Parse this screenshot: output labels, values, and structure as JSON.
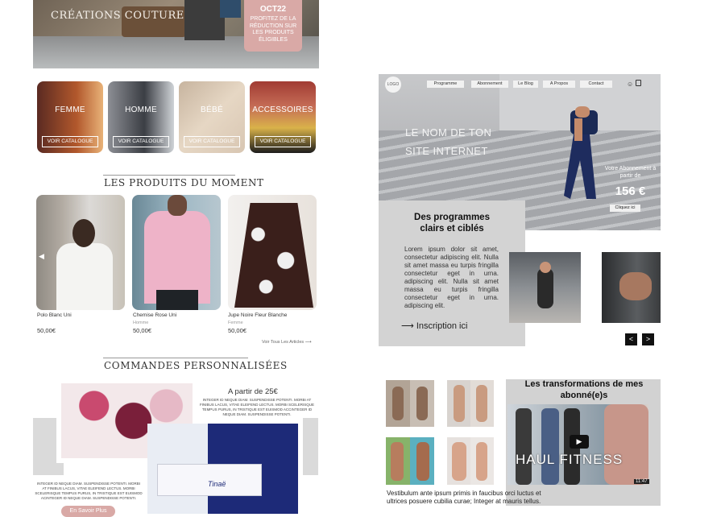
{
  "left_site": {
    "hero_title": "CRÉATIONS COUTURE",
    "promo": {
      "month": "OCT22",
      "text": "PROFITEZ DE LA RÉDUCTION SUR LES PRODUITS ÉLIGIBLES"
    },
    "categories": [
      {
        "label": "FEMME",
        "button": "VOIR CATALOGUE"
      },
      {
        "label": "HOMME",
        "button": "VOIR CATALOGUE"
      },
      {
        "label": "BÉBÉ",
        "button": "VOIR CATALOGUE"
      },
      {
        "label": "ACCESSOIRES",
        "button": "VOIR CATALOGUE"
      }
    ],
    "products_title": "LES PRODUITS DU MOMENT",
    "products": [
      {
        "name": "Polo Blanc Uni",
        "category": "",
        "price": "50,00€"
      },
      {
        "name": "Chemise Rose Uni",
        "category": "Homme",
        "price": "50,00€"
      },
      {
        "name": "Jupe Noire Fleur Blanche",
        "category": "Femme",
        "price": "50,00€"
      }
    ],
    "see_all": "Voir Tous Les Articles",
    "custom_title": "COMMANDES PERSONNALISÉES",
    "custom_price": "A partir de 25€",
    "custom_text_1": "INTEGER ID NEQUE DIAM. SUSPENDISSE POTENTI. MORBI AT FINIBUS LACUS, VITAE ELEIFEND LECTUS. MORBI SCELERISQUE TEMPUS PURUS, IN TRISTIQUE EST EUISMOD ACCINTEGER ID NEQUE DIAM. SUSPENDISSE POTENTI.",
    "custom_text_2": "INTEGER ID NEQUE DIAM. SUSPENDISSE POTENTI. MORBI AT FINIBUS LACUS, VITAE ELEIFEND LECTUS. MORBI SCELERISQUE TEMPUS PURUS, IN TRISTIQUE EST EUISMOD ACINTEGER ID NEQUE DIAM. SUSPENDISSE POTENTI.",
    "learn_more": "En Savoir Plus"
  },
  "right_site": {
    "logo": "LOGO",
    "nav": [
      "Programme",
      "Abonnement",
      "Le Blog",
      "A Propos",
      "Contact"
    ],
    "hero_title_1": "LE NOM DE TON",
    "hero_title_2": "SITE INTERNET",
    "subscription_text": "Votre Abonnement à partir de",
    "price": "156 €",
    "cta": "Cliquez ici",
    "prog_title": "Des programmes clairs et ciblés",
    "prog_text": "Lorem ipsum dolor sit amet, consectetur adipiscing elit. Nulla sit amet massa eu turpis fringilla consectetur eget in urna. adipiscing elit. Nulla sit amet massa eu turpis fringilla consectetur eget in urna. adipiscing elit.",
    "signup": "Inscription ici",
    "arrow_prev": "<",
    "arrow_next": ">",
    "trans_title": "Les transformations de mes abonné(e)s",
    "video_title": "HAUL FITNESS",
    "video_duration": "11:47",
    "vestibulum": "Vestibulum ante ipsum primis in faucibus orci luctus et ultrices posuere cubilia curae; Integer at mauris tellus."
  }
}
